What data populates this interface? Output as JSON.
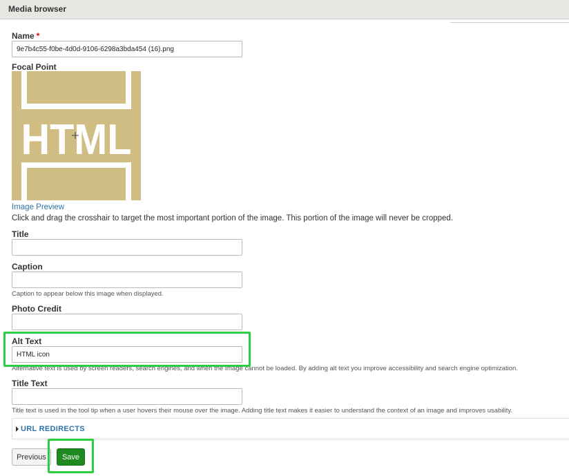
{
  "header": {
    "title": "Media browser"
  },
  "name_field": {
    "label": "Name",
    "required_mark": "*",
    "value": "9e7b4c55-f0be-4d0d-9106-6298a3bda454 (16).png"
  },
  "focal_point": {
    "label": "Focal Point",
    "image_text": "HTML",
    "link": "Image Preview",
    "help": "Click and drag the crosshair to target the most important portion of the image. This portion of the image will never be cropped."
  },
  "title_field": {
    "label": "Title",
    "value": ""
  },
  "caption_field": {
    "label": "Caption",
    "value": "",
    "description": "Caption to appear below this image when displayed."
  },
  "photo_credit_field": {
    "label": "Photo Credit",
    "value": ""
  },
  "alt_text_field": {
    "label": "Alt Text",
    "value": "HTML icon",
    "description": "Alternative text is used by screen readers, search engines, and when the image cannot be loaded. By adding alt text you improve accessibility and search engine optimization."
  },
  "title_text_field": {
    "label": "Title Text",
    "value": "",
    "description": "Title text is used in the tool tip when a user hovers their mouse over the image. Adding title text makes it easier to understand the context of an image and improves usability."
  },
  "url_redirects": {
    "label": "URL REDIRECTS"
  },
  "actions": {
    "previous": "Previous",
    "save": "Save"
  },
  "colors": {
    "accent_highlight": "#2ecc40",
    "save_button": "#1f8a1f",
    "focal_bg": "#cfbd84",
    "link": "#2f73a8"
  }
}
